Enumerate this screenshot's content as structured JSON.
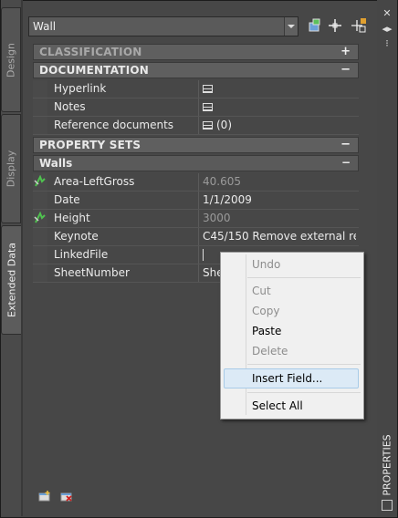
{
  "tabs": [
    "Design",
    "Display",
    "Extended Data"
  ],
  "style_combo": {
    "value": "Wall"
  },
  "palette_title": "PROPERTIES",
  "categories": {
    "classification": {
      "label": "CLASSIFICATION",
      "symbol": "+"
    },
    "documentation": {
      "label": "DOCUMENTATION",
      "symbol": "−"
    },
    "property_sets": {
      "label": "PROPERTY SETS",
      "symbol": "−"
    },
    "walls": {
      "label": "Walls",
      "symbol": "−"
    }
  },
  "documentation_rows": [
    {
      "name": "Hyperlink",
      "value": ""
    },
    {
      "name": "Notes",
      "value": ""
    },
    {
      "name": "Reference documents",
      "value": "(0)"
    }
  ],
  "walls_rows": [
    {
      "name": "Area-LeftGross",
      "value": "40.605"
    },
    {
      "name": "Date",
      "value": "1/1/2009"
    },
    {
      "name": "Height",
      "value": "3000"
    },
    {
      "name": "Keynote",
      "value": "C45/150 Remove external re..."
    },
    {
      "name": "LinkedFile",
      "value": ""
    },
    {
      "name": "SheetNumber",
      "value": "She"
    }
  ],
  "context_menu": {
    "items": [
      "Undo",
      "Cut",
      "Copy",
      "Paste",
      "Delete",
      "Insert Field...",
      "Select All"
    ]
  },
  "colors": {
    "accent_highlight": "#dceaf6",
    "panel_bg": "#474747"
  }
}
